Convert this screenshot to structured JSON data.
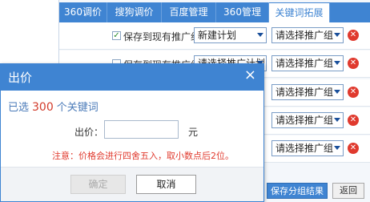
{
  "tabs": [
    {
      "label": "360调价"
    },
    {
      "label": "搜狗调价"
    },
    {
      "label": "百度管理"
    },
    {
      "label": "360管理"
    },
    {
      "label": "关键词拓展"
    }
  ],
  "rows": [
    {
      "checkbox_label": "保存到现有推广组",
      "plan": "新建计划",
      "group": "请选择推广组"
    },
    {
      "checkbox_label": "保存到现有推广组",
      "plan": "请选择推广计划",
      "group": "请选择推广组"
    }
  ],
  "footer": {
    "save_label": "保存分组结果",
    "back_label": "返回"
  },
  "dialog": {
    "title": "出价",
    "close_glyph": "×",
    "selected_prefix": "已选",
    "selected_count": "300",
    "selected_suffix": "个关键词",
    "price_label": "出价：",
    "price_value": "",
    "unit": "元",
    "note": "注意：价格会进行四舍五入，取小数点后2位。",
    "confirm_label": "确定",
    "cancel_label": "取消"
  },
  "colors": {
    "accent": "#3f84d2",
    "warning": "#e03a2e"
  }
}
